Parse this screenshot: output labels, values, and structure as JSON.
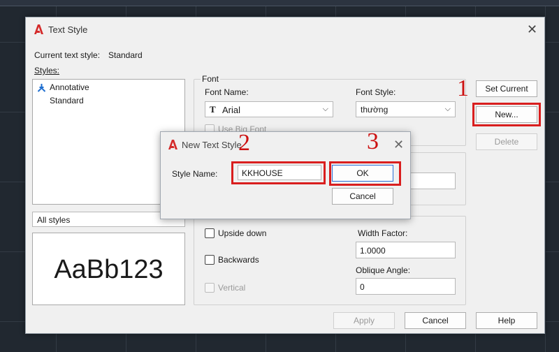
{
  "main_dialog": {
    "title": "Text Style",
    "current_style_label": "Current text style:",
    "current_style_value": "Standard",
    "styles_label": "Styles:",
    "styles_list": [
      {
        "label": "Annotative",
        "annotative": true
      },
      {
        "label": "Standard",
        "annotative": false
      }
    ],
    "filter_value": "All styles",
    "preview_text": "AaBb123",
    "font_group_label": "Font",
    "font_name_label": "Font Name:",
    "font_name_value": "Arial",
    "font_style_label": "Font Style:",
    "font_style_value": "thường",
    "use_big_font_label": "Use Big Font",
    "effects": {
      "upside_down_label": "Upside down",
      "backwards_label": "Backwards",
      "vertical_label": "Vertical",
      "width_factor_label": "Width Factor:",
      "width_factor_value": "1.0000",
      "oblique_angle_label": "Oblique Angle:",
      "oblique_angle_value": "0"
    },
    "buttons": {
      "set_current": "Set Current",
      "new": "New...",
      "delete": "Delete",
      "apply": "Apply",
      "cancel": "Cancel",
      "help": "Help"
    }
  },
  "new_style_dialog": {
    "title": "New Text Style",
    "style_name_label": "Style Name:",
    "style_name_value": "KKHOUSE",
    "ok": "OK",
    "cancel": "Cancel"
  },
  "annotations": [
    "1",
    "2",
    "3"
  ],
  "colors": {
    "annotation_red": "#d91e1e",
    "autocad_red": "#d42a2a",
    "annotative_blue": "#1f6fd0",
    "canvas_background": "#212830"
  }
}
